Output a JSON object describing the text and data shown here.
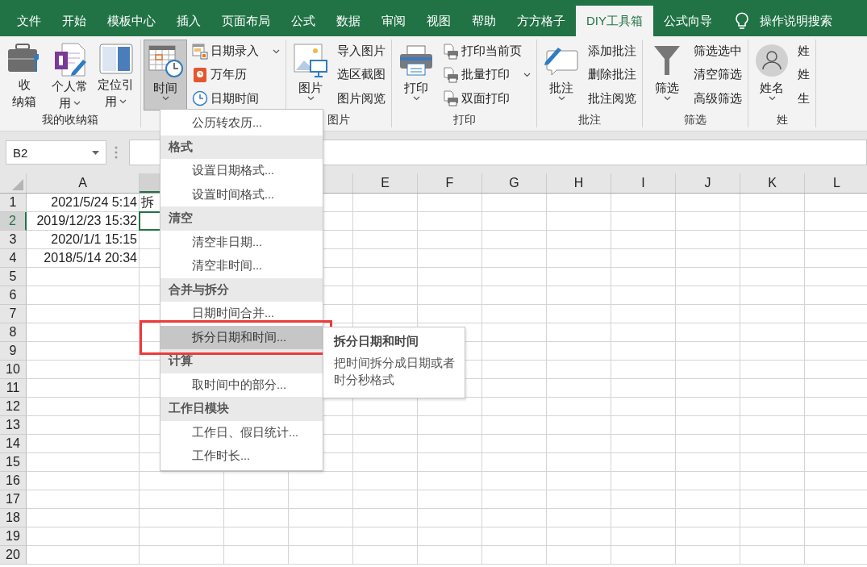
{
  "tabs": [
    {
      "label": "文件",
      "selected": false
    },
    {
      "label": "开始",
      "selected": false
    },
    {
      "label": "模板中心",
      "selected": false
    },
    {
      "label": "插入",
      "selected": false
    },
    {
      "label": "页面布局",
      "selected": false
    },
    {
      "label": "公式",
      "selected": false
    },
    {
      "label": "数据",
      "selected": false
    },
    {
      "label": "审阅",
      "selected": false
    },
    {
      "label": "视图",
      "selected": false
    },
    {
      "label": "帮助",
      "selected": false
    },
    {
      "label": "方方格子",
      "selected": false
    },
    {
      "label": "DIY工具箱",
      "selected": true
    },
    {
      "label": "公式向导",
      "selected": false
    }
  ],
  "tell_me": {
    "label": "操作说明搜索"
  },
  "ribbon": {
    "groups": [
      {
        "label": "我的收纳箱",
        "large": [
          {
            "lines": [
              "收",
              "纳箱"
            ],
            "dropdown": false,
            "pressed": false
          },
          {
            "lines": [
              "个人常",
              "用"
            ],
            "dropdown": true,
            "pressed": false
          },
          {
            "lines": [
              "定位引",
              "用"
            ],
            "dropdown": true,
            "pressed": false
          }
        ]
      },
      {
        "large": [
          {
            "lines": [
              "时间"
            ],
            "dropdown": true,
            "pressed": true
          }
        ],
        "small": [
          {
            "label": "日期录入",
            "dropdown": true
          },
          {
            "label": "万年历",
            "dropdown": false
          },
          {
            "label": "日期时间",
            "dropdown": false
          }
        ]
      },
      {
        "label": "图片",
        "large": [
          {
            "lines": [
              "图片"
            ],
            "dropdown": true,
            "pressed": false
          }
        ],
        "small": [
          {
            "label": "导入图片",
            "dropdown": false
          },
          {
            "label": "选区截图",
            "dropdown": false
          },
          {
            "label": "图片阅览",
            "dropdown": false
          }
        ]
      },
      {
        "label": "打印",
        "large": [
          {
            "lines": [
              "打印"
            ],
            "dropdown": true,
            "pressed": false
          }
        ],
        "small": [
          {
            "label": "打印当前页",
            "dropdown": false
          },
          {
            "label": "批量打印",
            "dropdown": true
          },
          {
            "label": "双面打印",
            "dropdown": false
          }
        ]
      },
      {
        "label": "批注",
        "large": [
          {
            "lines": [
              "批注"
            ],
            "dropdown": true,
            "pressed": false
          }
        ],
        "small": [
          {
            "label": "添加批注",
            "dropdown": false
          },
          {
            "label": "删除批注",
            "dropdown": false
          },
          {
            "label": "批注阅览",
            "dropdown": false
          }
        ]
      },
      {
        "label": "筛选",
        "large": [
          {
            "lines": [
              "筛选"
            ],
            "dropdown": true,
            "pressed": false
          }
        ],
        "small": [
          {
            "label": "筛选选中",
            "dropdown": false
          },
          {
            "label": "清空筛选",
            "dropdown": false
          },
          {
            "label": "高级筛选",
            "dropdown": false
          }
        ]
      },
      {
        "label": "姓",
        "large": [
          {
            "lines": [
              "姓名"
            ],
            "dropdown": true,
            "pressed": false
          }
        ],
        "small": [
          {
            "label": "姓",
            "dropdown": false
          },
          {
            "label": "姓",
            "dropdown": false
          },
          {
            "label": "生",
            "dropdown": false
          }
        ]
      }
    ]
  },
  "name_box": "B2",
  "columns": [
    {
      "label": "A",
      "selected": false
    },
    {
      "selected": true
    },
    {},
    {
      "selected": false
    },
    {
      "label": "E",
      "selected": false
    },
    {
      "label": "F",
      "selected": false
    },
    {
      "label": "G",
      "selected": false
    },
    {
      "label": "H",
      "selected": false
    },
    {
      "label": "I",
      "selected": false
    },
    {
      "label": "J",
      "selected": false
    },
    {
      "label": "K",
      "selected": false
    },
    {
      "label": "L",
      "selected": false
    }
  ],
  "rows": [
    {
      "number": "1",
      "selected": false,
      "cells": [
        {
          "text": "2021/5/24 5:14",
          "active": false
        },
        {
          "text": "拆",
          "active": false
        }
      ]
    },
    {
      "number": "2",
      "selected": true,
      "cells": [
        {
          "text": "2019/12/23 15:32",
          "active": false
        },
        {
          "active": true
        }
      ]
    },
    {
      "number": "3",
      "selected": false,
      "cells": [
        {
          "text": "2020/1/1 15:15",
          "active": false
        }
      ]
    },
    {
      "number": "4",
      "selected": false,
      "cells": [
        {
          "text": "2018/5/14 20:34",
          "active": false
        }
      ]
    },
    {
      "number": "5",
      "selected": false
    },
    {
      "number": "6",
      "selected": false
    },
    {
      "number": "7",
      "selected": false
    },
    {
      "number": "8",
      "selected": false
    },
    {
      "number": "9",
      "selected": false
    },
    {
      "number": "10",
      "selected": false
    },
    {
      "number": "11",
      "selected": false
    },
    {
      "number": "12",
      "selected": false
    },
    {
      "number": "13",
      "selected": false
    },
    {
      "number": "14",
      "selected": false
    },
    {
      "number": "15",
      "selected": false
    },
    {
      "number": "16",
      "selected": false
    },
    {
      "number": "17",
      "selected": false
    },
    {
      "number": "18",
      "selected": false
    },
    {
      "number": "19",
      "selected": false
    },
    {
      "number": "20",
      "selected": false
    }
  ],
  "menu": {
    "entries": [
      {
        "kind": "item",
        "label": "公历转农历...",
        "selected": false
      },
      {
        "kind": "header",
        "label": "格式"
      },
      {
        "kind": "item",
        "label": "设置日期格式...",
        "selected": false
      },
      {
        "kind": "item",
        "label": "设置时间格式...",
        "selected": false
      },
      {
        "kind": "header",
        "label": "清空"
      },
      {
        "kind": "item",
        "label": "清空非日期...",
        "selected": false
      },
      {
        "kind": "item",
        "label": "清空非时间...",
        "selected": false
      },
      {
        "kind": "header",
        "label": "合并与拆分"
      },
      {
        "kind": "item",
        "label": "日期时间合并...",
        "selected": false
      },
      {
        "kind": "item",
        "label": "拆分日期和时间...",
        "selected": true
      },
      {
        "kind": "header",
        "label": "计算"
      },
      {
        "kind": "item",
        "label": "取时间中的部分...",
        "selected": false
      },
      {
        "kind": "header",
        "label": "工作日模块"
      },
      {
        "kind": "item",
        "label": "工作日、假日统计...",
        "selected": false
      },
      {
        "kind": "item",
        "label": "工作时长...",
        "selected": false
      }
    ]
  },
  "tooltip": {
    "title": "拆分日期和时间",
    "text": "把时间拆分成日期或者时分秒格式"
  }
}
